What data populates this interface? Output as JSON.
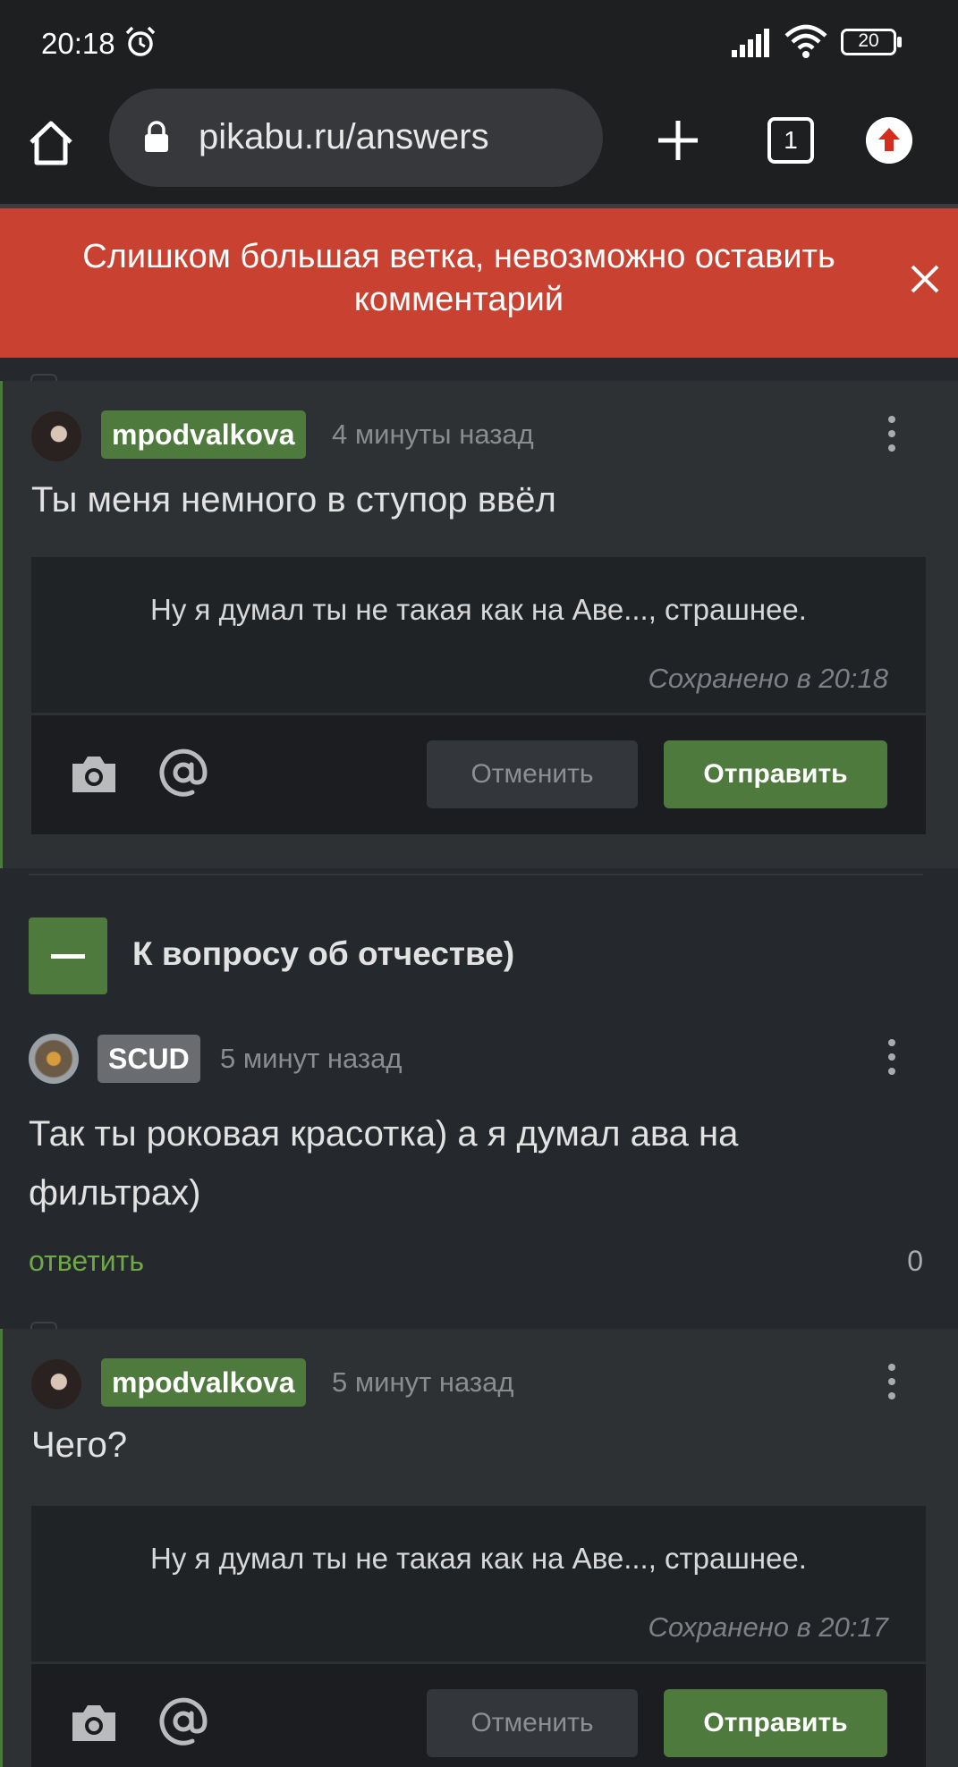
{
  "status_bar": {
    "time": "20:18",
    "battery": "20"
  },
  "browser": {
    "url": "pikabu.ru/answers",
    "tab_count": "1"
  },
  "banner": {
    "message": "Слишком большая ветка, невозможно оставить комментарий"
  },
  "comments": [
    {
      "user": "mpodvalkova",
      "time": "4 минуты назад",
      "text": "Ты меня немного в ступор ввёл",
      "editor": {
        "draft": "Ну я думал ты не такая как на Аве..., страшнее.",
        "saved": "Сохранено в 20:18",
        "cancel": "Отменить",
        "send": "Отправить"
      }
    },
    {
      "thread_title": "К вопросу об отчестве)",
      "user": "SCUD",
      "time": "5 минут назад",
      "text": "Так ты роковая красотка) а я думал ава на фильтрах)",
      "reply_label": "ответить",
      "rating": "0"
    },
    {
      "user": "mpodvalkova",
      "time": "5 минут назад",
      "text": "Чего?",
      "editor": {
        "draft": "Ну я думал ты не такая как на Аве..., страшнее.",
        "saved": "Сохранено в 20:17",
        "cancel": "Отменить",
        "send": "Отправить"
      }
    }
  ],
  "colors": {
    "accent_green": "#4f7a3e",
    "error_red": "#c84131",
    "link_green": "#6ea847",
    "background": "#25282c"
  }
}
